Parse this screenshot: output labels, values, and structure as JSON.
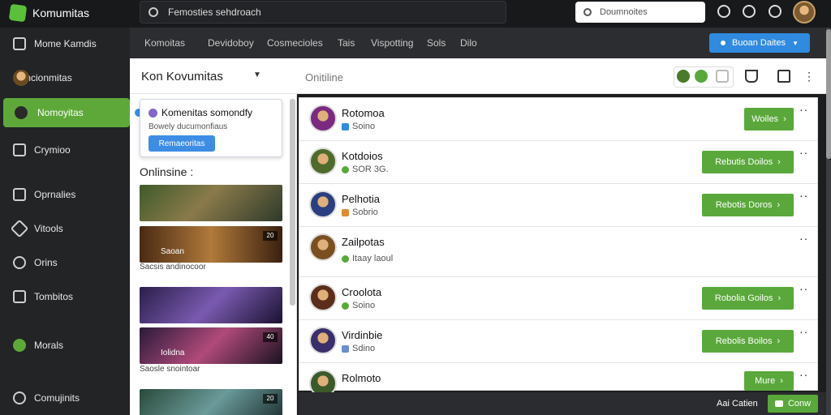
{
  "app": {
    "name": "Komumitas",
    "brand_color": "#5ea83a"
  },
  "topbar": {
    "search_query": "Femosties sehdroach",
    "right_search_query": "Doumnoites"
  },
  "sidebar": {
    "items": [
      {
        "label": "Mome Kamdis",
        "icon": "building-icon"
      },
      {
        "label": "Concionmitas",
        "icon": "user-avatar"
      },
      {
        "label": "Nomoyitas",
        "icon": "avatar-badge",
        "active": true
      },
      {
        "label": "Crymioo",
        "icon": "gift-icon"
      },
      {
        "label": "Oprnalies",
        "icon": "list-icon"
      },
      {
        "label": "Vitools",
        "icon": "tool-icon"
      },
      {
        "label": "Orins",
        "icon": "search-icon"
      },
      {
        "label": "Tombitos",
        "icon": "home-icon"
      },
      {
        "label": "Morals",
        "icon": "green-dot-icon"
      },
      {
        "label": "Comujinits",
        "icon": "group-icon"
      }
    ]
  },
  "tabs": [
    "Komoitas",
    "Devidoboy",
    "Cosmecioles",
    "Tais",
    "Vispotting",
    "Sols",
    "Dilo"
  ],
  "join_button_label": "Buoan Daites",
  "header": {
    "title": "Kon Kovumitas",
    "status": "Onitiline"
  },
  "popup": {
    "title": "Komenitas somondfy",
    "subtitle": "Bowely ducumonfiaus",
    "button": "Remaeoritas"
  },
  "online_label": "Onlinsine :",
  "thumbnails": [
    {
      "caption": "",
      "badge": ""
    },
    {
      "caption": "Saoan",
      "badge": "20"
    },
    {
      "caption": "",
      "badge": ""
    },
    {
      "caption": "Iolidna",
      "badge": "40"
    },
    {
      "caption": "",
      "badge": "20"
    }
  ],
  "thumbnail_labels": [
    "Sacsis andinocoor",
    "Saosle snointoar"
  ],
  "friends": [
    {
      "name": "Rotomoa",
      "status": "Soino",
      "status_color": "#2f8ae0",
      "button": "Woiles",
      "avatar_color": "#7a2a7f"
    },
    {
      "name": "Kotdoios",
      "status": "SOR 3G.",
      "status_color": "#5aa83b",
      "button": "Rebutis Doilos",
      "avatar_color": "#4f6b2b"
    },
    {
      "name": "Pelhotia",
      "status": "Sobrio",
      "status_color": "#e08a2f",
      "button": "Rebotis Doros",
      "avatar_color": "#2b3f80"
    },
    {
      "name": "Zailpotas",
      "status": "Itaay laoul",
      "status_color": "#5aa83b",
      "button": "",
      "avatar_color": "#7a5020"
    },
    {
      "name": "Croolota",
      "status": "Soino",
      "status_color": "#5aa83b",
      "button": "Robolia Goilos",
      "avatar_color": "#5a2e1a"
    },
    {
      "name": "Virdinbie",
      "status": "Sdino",
      "status_color": "#6b8ed0",
      "button": "Rebolis Boilos",
      "avatar_color": "#3a2f6b"
    },
    {
      "name": "Rolmoto",
      "status": "",
      "status_color": "#5aa83b",
      "button": "Mure",
      "avatar_color": "#3a5a2a"
    }
  ],
  "bottombar": {
    "text": "Aai Catien",
    "button": "Conw"
  }
}
